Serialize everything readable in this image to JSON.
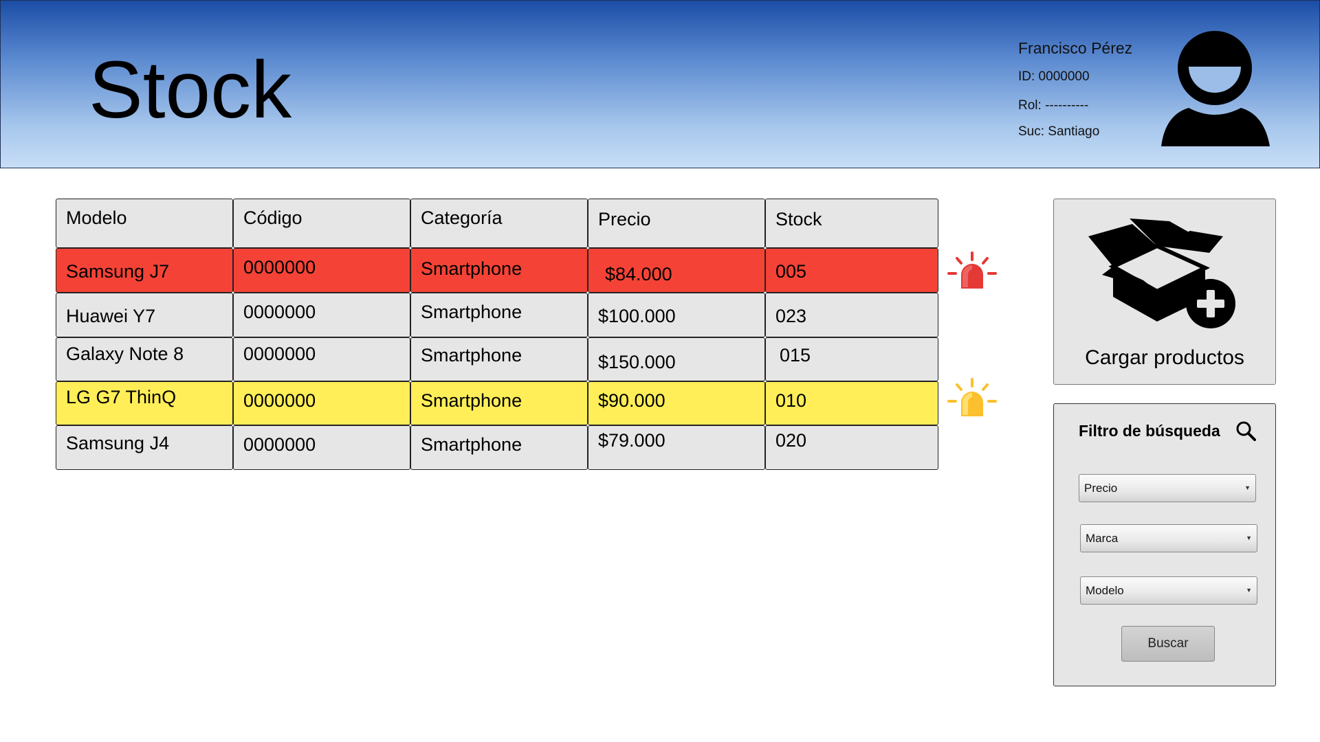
{
  "header": {
    "title": "Stock",
    "user": {
      "name": "Francisco Pérez",
      "id": "ID: 0000000",
      "role": "Rol: ----------",
      "branch": "Suc: Santiago"
    },
    "avatar_icon": "user-avatar-icon"
  },
  "table": {
    "columns": [
      "Modelo",
      "Código",
      "Categoría",
      "Precio",
      "Stock"
    ],
    "rows": [
      {
        "modelo": "Samsung J7",
        "codigo": "0000000",
        "categoria": "Smartphone",
        "precio": "$84.000",
        "stock": "005",
        "status": "critical",
        "color": "#f44336"
      },
      {
        "modelo": "Huawei Y7",
        "codigo": "0000000",
        "categoria": "Smartphone",
        "precio": "$100.000",
        "stock": "023",
        "status": "normal",
        "color": "#e6e6e6"
      },
      {
        "modelo": "Galaxy Note 8",
        "codigo": "0000000",
        "categoria": "Smartphone",
        "precio": "$150.000",
        "stock": "015",
        "status": "normal",
        "color": "#e6e6e6"
      },
      {
        "modelo": "LG G7 ThinQ",
        "codigo": "0000000",
        "categoria": "Smartphone",
        "precio": "$90.000",
        "stock": "010",
        "status": "warning",
        "color": "#ffee58"
      },
      {
        "modelo": "Samsung J4",
        "codigo": "0000000",
        "categoria": "Smartphone",
        "precio": "$79.000",
        "stock": "020",
        "status": "normal",
        "color": "#e6e6e6"
      }
    ],
    "alerts": [
      {
        "icon": "siren-red-icon",
        "color": "#e53935"
      },
      {
        "icon": "siren-yellow-icon",
        "color": "#fbc02d"
      }
    ]
  },
  "load_products": {
    "label": "Cargar productos",
    "icon": "open-box-add-icon"
  },
  "filter": {
    "title": "Filtro de búsqueda",
    "icon": "search-icon",
    "selects": [
      {
        "value": "Precio"
      },
      {
        "value": "Marca"
      },
      {
        "value": "Modelo"
      }
    ],
    "button_label": "Buscar"
  }
}
